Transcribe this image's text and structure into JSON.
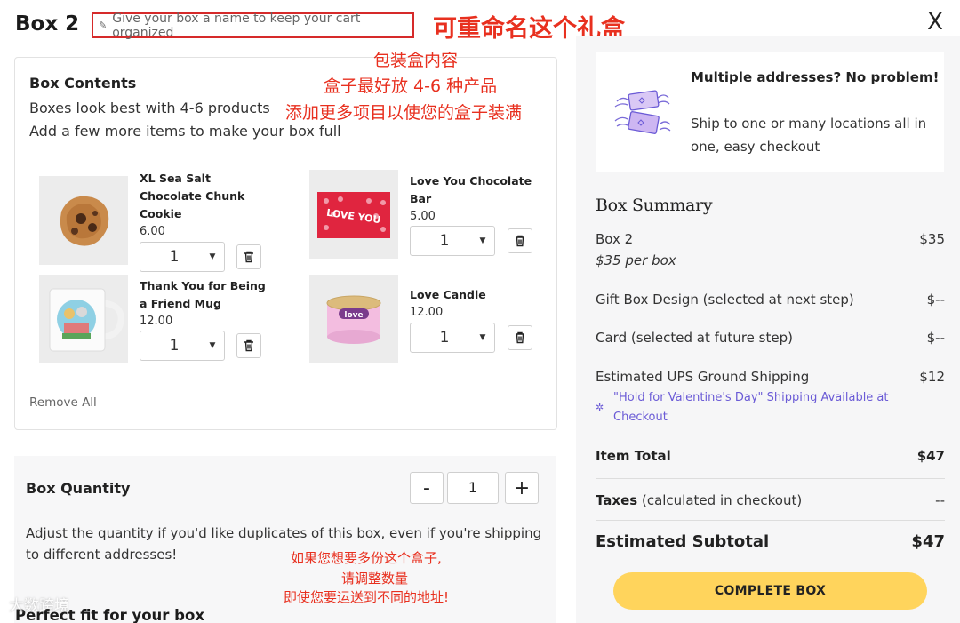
{
  "header": {
    "box_title": "Box 2",
    "rename_placeholder": "Give your box a name to keep your cart organized",
    "close_label": "X"
  },
  "annotations": {
    "rename": "可重命名这个礼盒",
    "contents_lines": [
      "包装盒内容",
      "盒子最好放 4-6 种产品",
      "添加更多项目以使您的盒子装满"
    ],
    "quantity_lines": [
      "如果您想要多份这个盒子,",
      "请调整数量",
      "即使您要运送到不同的地址!"
    ]
  },
  "contents": {
    "heading": "Box Contents",
    "line1": "Boxes look best with 4-6 products",
    "line2": "Add a few more items to make your box full",
    "remove_all": "Remove All",
    "products": [
      {
        "name_lines": [
          "XL Sea Salt",
          "Chocolate Chunk",
          "Cookie"
        ],
        "price": "6.00",
        "qty": "1"
      },
      {
        "name_lines": [
          "Love You Chocolate",
          "Bar"
        ],
        "price": "5.00",
        "qty": "1"
      },
      {
        "name_lines": [
          "Thank You for Being",
          "a Friend Mug"
        ],
        "price": "12.00",
        "qty": "1"
      },
      {
        "name_lines": [
          "Love Candle"
        ],
        "price": "12.00",
        "qty": "1"
      }
    ],
    "chocolate_wrapper_text": "LOVE YOU",
    "candle_label": "love"
  },
  "quantity": {
    "heading": "Box Quantity",
    "minus": "-",
    "plus": "+",
    "value": "1",
    "desc": "Adjust the quantity if you'd like duplicates of this box, even if you're shipping to different addresses!"
  },
  "perfect_fit": "Perfect fit for your box",
  "watermark": "大数跨境",
  "multi_address": {
    "title": "Multiple addresses? No problem!",
    "body": "Ship to one or many locations all in one, easy checkout"
  },
  "summary": {
    "title": "Box Summary",
    "box_label": "Box 2",
    "box_price": "$35",
    "per_box": "$35 per box",
    "gift_design_label": "Gift Box Design (selected at next step)",
    "gift_design_value": "$--",
    "card_label": "Card (selected at future step)",
    "card_value": "$--",
    "shipping_label": "Estimated UPS Ground Shipping",
    "shipping_value": "$12",
    "valentine_note": "\"Hold for Valentine's Day\" Shipping Available at Checkout",
    "item_total_label": "Item Total",
    "item_total_value": "$47",
    "taxes_label_bold": "Taxes",
    "taxes_label_rest": " (calculated in checkout)",
    "taxes_value": "--",
    "subtotal_label": "Estimated Subtotal",
    "subtotal_value": "$47",
    "complete_button": "COMPLETE BOX"
  },
  "colors": {
    "accent_yellow": "#ffd45c",
    "annotation_red": "#e8301f",
    "link_purple": "#6b5bd6"
  }
}
